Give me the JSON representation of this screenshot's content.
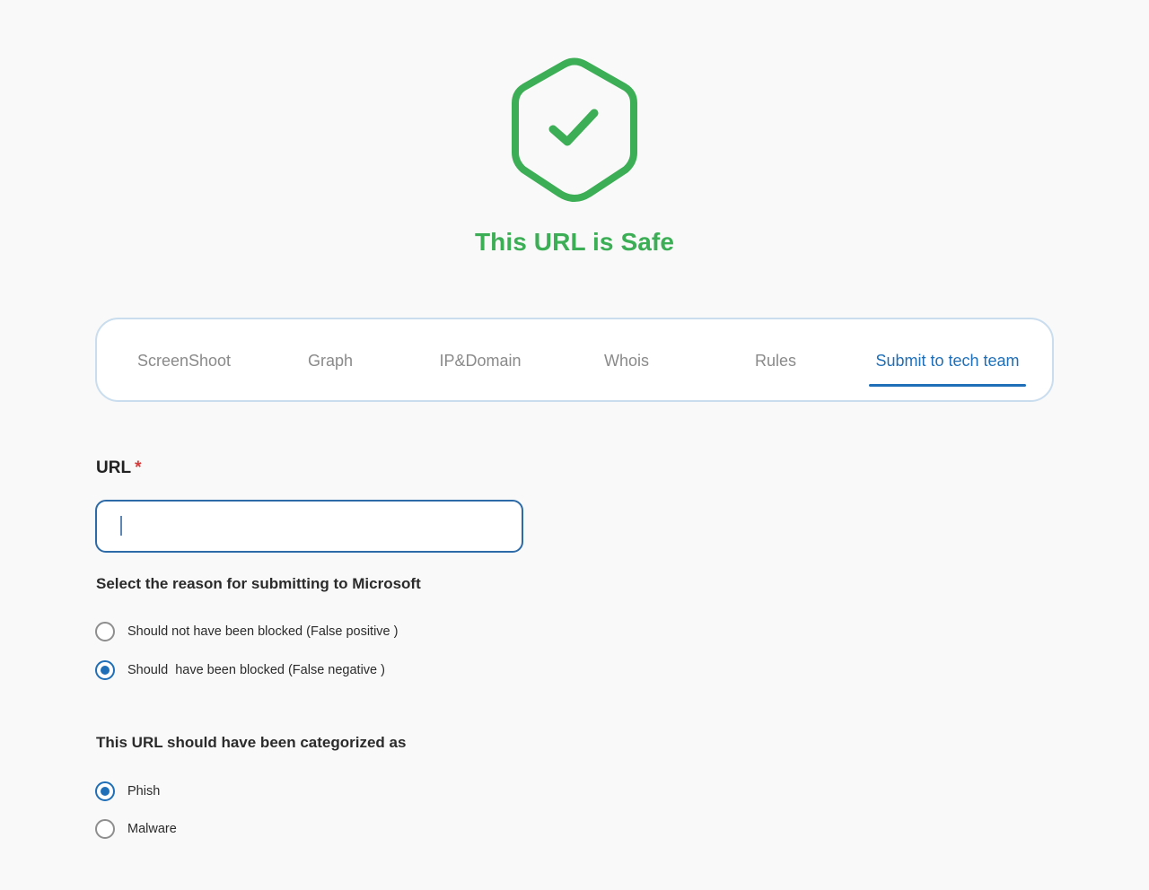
{
  "status": {
    "icon": "shield-check-icon",
    "title": "This URL is Safe",
    "color": "#3cae55"
  },
  "tabs": [
    {
      "label": "ScreenShoot",
      "active": false
    },
    {
      "label": "Graph",
      "active": false
    },
    {
      "label": "IP&Domain",
      "active": false
    },
    {
      "label": "Whois",
      "active": false
    },
    {
      "label": "Rules",
      "active": false
    },
    {
      "label": "Submit to tech team",
      "active": true
    }
  ],
  "form": {
    "url_label": "URL",
    "required_marker": "*",
    "url_value": "",
    "reason_title": "Select the reason for submitting to Microsoft",
    "reasons": [
      {
        "label": "Should not have been blocked (False positive )",
        "checked": false
      },
      {
        "label": "Should  have been blocked (False negative )",
        "checked": true
      }
    ],
    "category_title": "This URL should have been categorized as",
    "categories": [
      {
        "label": "Phish",
        "checked": true
      },
      {
        "label": "Malware",
        "checked": false
      }
    ]
  },
  "colors": {
    "accent": "#1e6fb8",
    "safe": "#3cae55",
    "required": "#d43b3b"
  }
}
